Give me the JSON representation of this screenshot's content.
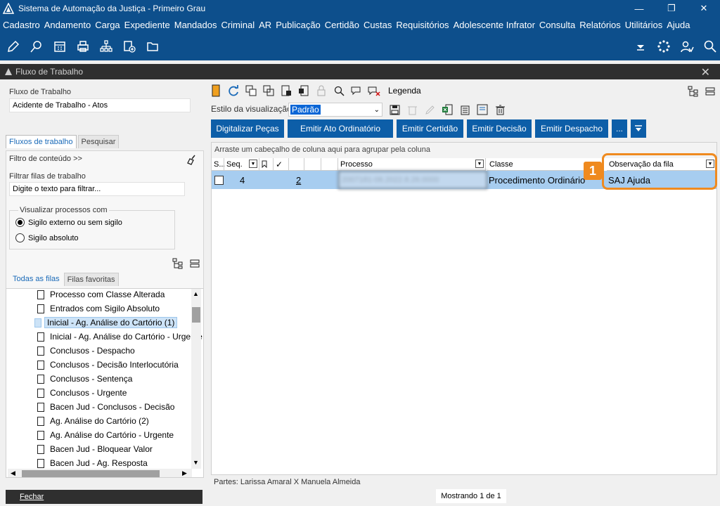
{
  "window": {
    "title": "Sistema de Automação da Justiça - Primeiro Grau"
  },
  "menu": [
    "Cadastro",
    "Andamento",
    "Carga",
    "Expediente",
    "Mandados",
    "Criminal",
    "AR",
    "Publicação",
    "Certidão",
    "Custas",
    "Requisitórios",
    "Adolescente Infrator",
    "Consulta",
    "Relatórios",
    "Utilitários",
    "Ajuda"
  ],
  "subwindow": {
    "title": "Fluxo de Trabalho"
  },
  "left": {
    "fluxo_label": "Fluxo de Trabalho",
    "fluxo_value": "Acidente de Trabalho - Atos",
    "tabs": [
      "Fluxos de trabalho",
      "Pesquisar"
    ],
    "filtro_conteudo": "Filtro de conteúdo >>",
    "filtrar_label": "Filtrar filas de trabalho",
    "filtrar_placeholder": "Digite o texto para filtrar...",
    "visualizar_label": "Visualizar processos com",
    "radio1": "Sigilo externo ou sem sigilo",
    "radio2": "Sigilo absoluto",
    "queue_tabs": [
      "Todas as filas",
      "Filas favoritas"
    ],
    "tree": [
      "Processo com Classe Alterada",
      "Entrados com Sigilo Absoluto",
      "Inicial - Ag. Análise do Cartório (1)",
      "Inicial - Ag. Análise do Cartório - Urgente",
      "Conclusos - Despacho",
      "Conclusos - Decisão Interlocutória",
      "Conclusos - Sentença",
      "Conclusos - Urgente",
      "Bacen Jud - Conclusos - Decisão",
      "Ag. Análise do Cartório (2)",
      "Ag. Análise do Cartório - Urgente",
      "Bacen Jud - Bloquear Valor",
      "Bacen Jud - Ag. Resposta"
    ],
    "fechar": "Fechar"
  },
  "right": {
    "legenda": "Legenda",
    "estilo_label": "Estilo da visualização",
    "estilo_value": "Padrão",
    "buttons": [
      "Digitalizar Peças",
      "Emitir Ato Ordinatório",
      "Emitir Certidão",
      "Emitir Decisão",
      "Emitir Despacho",
      "..."
    ],
    "group_hint": "Arraste um cabeçalho de coluna aqui para agrupar pela coluna",
    "columns": {
      "s": "S...",
      "seq": "Seq.",
      "processo": "Processo",
      "classe": "Classe",
      "obs": "Observação da fila"
    },
    "row": {
      "seq": "4",
      "count": "2",
      "processo": "2007181-06.2022.8.26.0000",
      "classe": "Procedimento Ordinário",
      "obs": "SAJ Ajuda"
    },
    "callout": "1",
    "partes": "Partes: Larissa Amaral  X  Manuela Almeida",
    "mostrando": "Mostrando 1 de 1"
  },
  "colors": {
    "brand": "#0d4f8c",
    "button": "#0d5ea8",
    "highlight": "#ef8a1f",
    "selected_row": "#a7cdf0"
  }
}
